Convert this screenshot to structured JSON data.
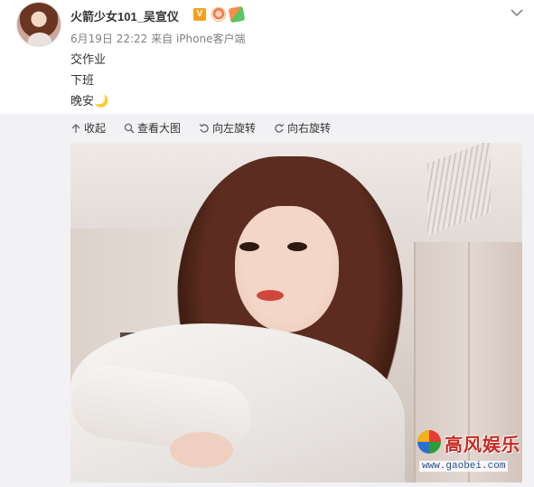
{
  "post": {
    "username": "火箭少女101_吴宣仪",
    "verified_mark": "V",
    "meta": {
      "date": "6月19日 22:22",
      "source": "来自 iPhone客户端"
    },
    "content_lines": [
      "交作业",
      "下班",
      "晚安🌙"
    ]
  },
  "toolbar": {
    "collapse_label": "收起",
    "view_large_label": "查看大图",
    "rotate_left_label": "向左旋转",
    "rotate_right_label": "向右旋转"
  },
  "watermark": {
    "title": "高风娱乐",
    "url": "www.gaobei.com"
  },
  "icons": {
    "collapse": "arrow-up-icon",
    "view_large": "magnifier-icon",
    "rotate_left": "rotate-left-icon",
    "rotate_right": "rotate-right-icon",
    "more": "chevron-down-icon"
  },
  "colors": {
    "verified_badge": "#f6a021",
    "toolbar_bg": "#f2f2f5",
    "meta_text": "#808080",
    "watermark_red": "#c8281f",
    "watermark_blue": "#1f4e9a"
  }
}
